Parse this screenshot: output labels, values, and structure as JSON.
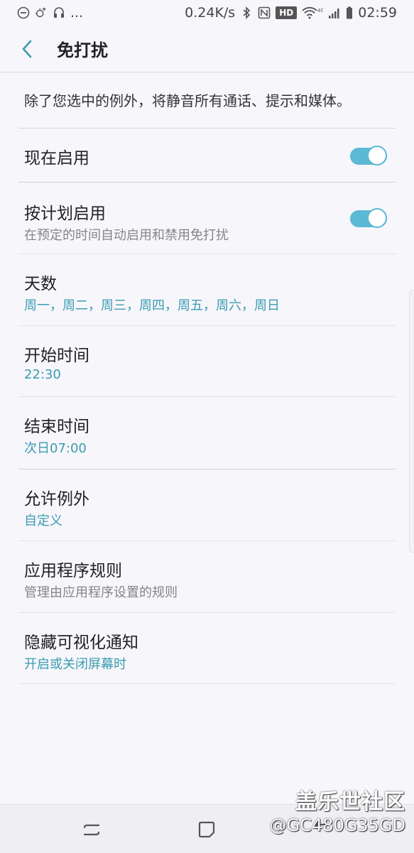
{
  "status_bar": {
    "left_icons": [
      "dnd-circle-icon",
      "mobile-data-saver-icon",
      "headphones-icon"
    ],
    "left_more": "...",
    "speed": "0.24K/s",
    "hd_badge": "HD",
    "network_label": "4G",
    "time": "02:59",
    "right_icons": [
      "bluetooth-icon",
      "nfc-icon",
      "wifi-icon",
      "signal-icon",
      "battery-icon"
    ]
  },
  "header": {
    "title": "免打扰",
    "back_icon": "chevron-left-icon"
  },
  "main": {
    "description": "除了您选中的例外，将静音所有通话、提示和媒体。",
    "rows": [
      {
        "title": "现在启用",
        "toggle": true
      },
      {
        "title": "按计划启用",
        "subtitle": "在预定的时间自动启用和禁用免打扰",
        "toggle": true
      },
      {
        "title": "天数",
        "subtitle": "周一，周二，周三，周四，周五，周六，周日"
      },
      {
        "title": "开始时间",
        "subtitle": "22:30"
      },
      {
        "title": "结束时间",
        "subtitle": "次日07:00"
      },
      {
        "title": "允许例外",
        "subtitle": "自定义"
      },
      {
        "title": "应用程序规则",
        "subtitle": "管理由应用程序设置的规则"
      },
      {
        "title": "隐藏可视化通知",
        "subtitle": "开启或关闭屏幕时"
      }
    ]
  },
  "nav_bar": {
    "icons": [
      "recent-apps-icon",
      "home-icon",
      "back-icon"
    ]
  },
  "watermark": {
    "brand": "盖乐世社区",
    "user": "@GC480G35GD"
  },
  "colors": {
    "accent": "#3a9cb0",
    "toggle_track": "#5bb9d3",
    "background": "#f7f6fb"
  }
}
